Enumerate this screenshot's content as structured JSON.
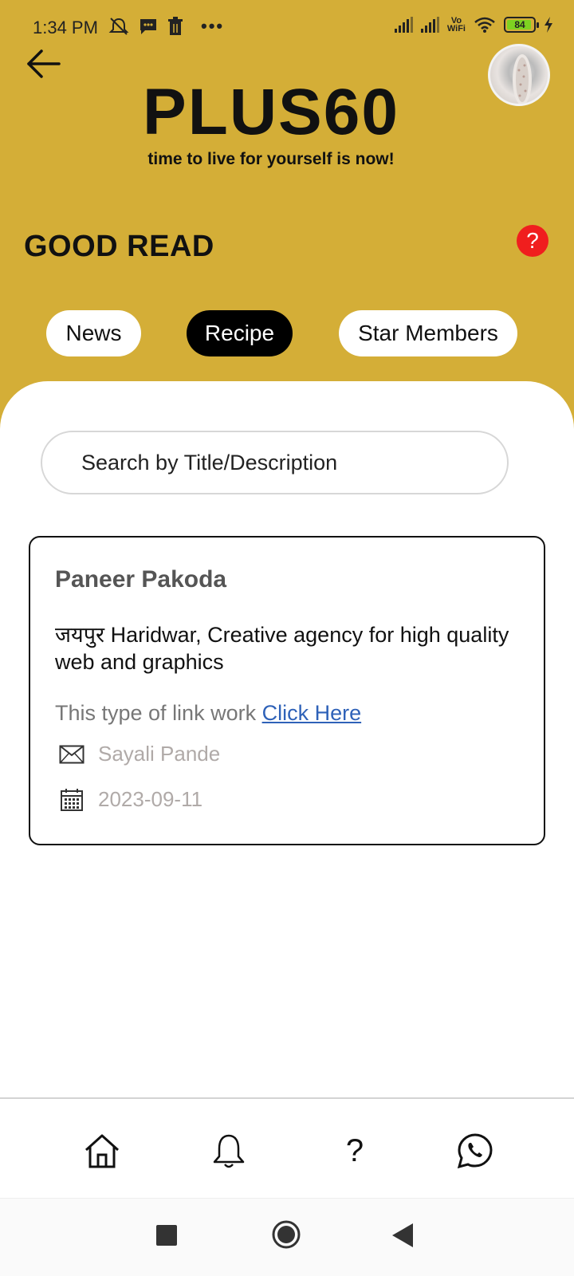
{
  "status_bar": {
    "time": "1:34 PM",
    "left_icons": [
      "mute-icon",
      "message-icon",
      "trash-icon",
      "more-icon"
    ],
    "vowifi_label": "Vo\nWiFi",
    "battery": "84"
  },
  "header": {
    "logo_text": "PLUS60",
    "tagline": "time to live for yourself is now!",
    "section_title": "GOOD READ",
    "help_label": "?"
  },
  "tabs": [
    {
      "label": "News",
      "active": false
    },
    {
      "label": "Recipe",
      "active": true
    },
    {
      "label": "Star Members",
      "active": false
    }
  ],
  "search": {
    "placeholder": "Search by Title/Description",
    "value": ""
  },
  "card": {
    "title": "Paneer Pakoda",
    "description": "जयपुर Haridwar, Creative agency for high quality web and graphics",
    "link_prefix": "This type of link work ",
    "link_text": "Click Here",
    "author": "Sayali Pande",
    "date": "2023-09-11"
  },
  "bottom_nav": [
    {
      "icon": "home-icon"
    },
    {
      "icon": "bell-icon"
    },
    {
      "icon": "question-icon",
      "label": "?"
    },
    {
      "icon": "whatsapp-icon"
    }
  ],
  "colors": {
    "header_bg": "#d4ae37",
    "active_tab": "#000000",
    "help_badge": "#f01e1e",
    "link": "#2f62b8",
    "meta_text": "#b0aaa8"
  }
}
